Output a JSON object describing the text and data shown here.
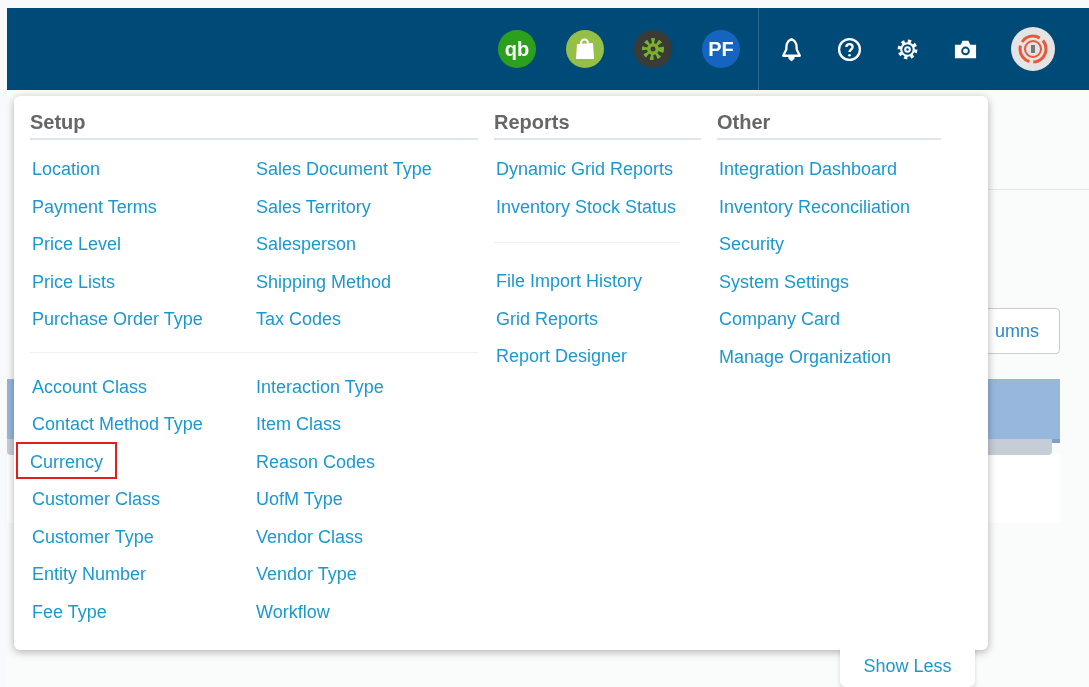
{
  "header": {
    "apps": [
      {
        "kind": "quickbooks",
        "mark": "qb"
      },
      {
        "kind": "shopify"
      },
      {
        "kind": "gear"
      },
      {
        "kind": "pf",
        "mark": "PF"
      }
    ]
  },
  "background": {
    "columns_button": "umns"
  },
  "menu": {
    "sections": [
      {
        "title": "Setup",
        "columns": [
          {
            "groups": [
              {
                "items": [
                  {
                    "label": "Location",
                    "highlighted": false
                  },
                  {
                    "label": "Payment Terms",
                    "highlighted": false
                  },
                  {
                    "label": "Price Level",
                    "highlighted": false
                  },
                  {
                    "label": "Price Lists",
                    "highlighted": false
                  },
                  {
                    "label": "Purchase Order Type",
                    "highlighted": false
                  }
                ]
              },
              {
                "items": [
                  {
                    "label": "Account Class",
                    "highlighted": false
                  },
                  {
                    "label": "Contact Method Type",
                    "highlighted": false
                  },
                  {
                    "label": "Currency",
                    "highlighted": true
                  },
                  {
                    "label": "Customer Class",
                    "highlighted": false
                  },
                  {
                    "label": "Customer Type",
                    "highlighted": false
                  },
                  {
                    "label": "Entity Number",
                    "highlighted": false
                  },
                  {
                    "label": "Fee Type",
                    "highlighted": false
                  }
                ]
              }
            ]
          },
          {
            "groups": [
              {
                "items": [
                  {
                    "label": "Sales Document Type",
                    "highlighted": false
                  },
                  {
                    "label": "Sales Territory",
                    "highlighted": false
                  },
                  {
                    "label": "Salesperson",
                    "highlighted": false
                  },
                  {
                    "label": "Shipping Method",
                    "highlighted": false
                  },
                  {
                    "label": "Tax Codes",
                    "highlighted": false
                  }
                ]
              },
              {
                "items": [
                  {
                    "label": "Interaction Type",
                    "highlighted": false
                  },
                  {
                    "label": "Item Class",
                    "highlighted": false
                  },
                  {
                    "label": "Reason Codes",
                    "highlighted": false
                  },
                  {
                    "label": "UofM Type",
                    "highlighted": false
                  },
                  {
                    "label": "Vendor Class",
                    "highlighted": false
                  },
                  {
                    "label": "Vendor Type",
                    "highlighted": false
                  },
                  {
                    "label": "Workflow",
                    "highlighted": false
                  }
                ]
              }
            ]
          }
        ]
      },
      {
        "title": "Reports",
        "columns": [
          {
            "groups": [
              {
                "items": [
                  {
                    "label": "Dynamic Grid Reports",
                    "highlighted": false
                  },
                  {
                    "label": "Inventory Stock Status",
                    "highlighted": false
                  }
                ]
              },
              {
                "items": [
                  {
                    "label": "File Import History",
                    "highlighted": false
                  },
                  {
                    "label": "Grid Reports",
                    "highlighted": false
                  },
                  {
                    "label": "Report Designer",
                    "highlighted": false
                  }
                ]
              }
            ]
          }
        ]
      },
      {
        "title": "Other",
        "columns": [
          {
            "groups": [
              {
                "items": [
                  {
                    "label": "Integration Dashboard",
                    "highlighted": false
                  },
                  {
                    "label": "Inventory Reconciliation",
                    "highlighted": false
                  },
                  {
                    "label": "Security",
                    "highlighted": false
                  },
                  {
                    "label": "System Settings",
                    "highlighted": false
                  },
                  {
                    "label": "Company Card",
                    "highlighted": false
                  },
                  {
                    "label": "Manage Organization",
                    "highlighted": false
                  }
                ]
              }
            ]
          }
        ]
      }
    ],
    "show_less": "Show Less"
  }
}
